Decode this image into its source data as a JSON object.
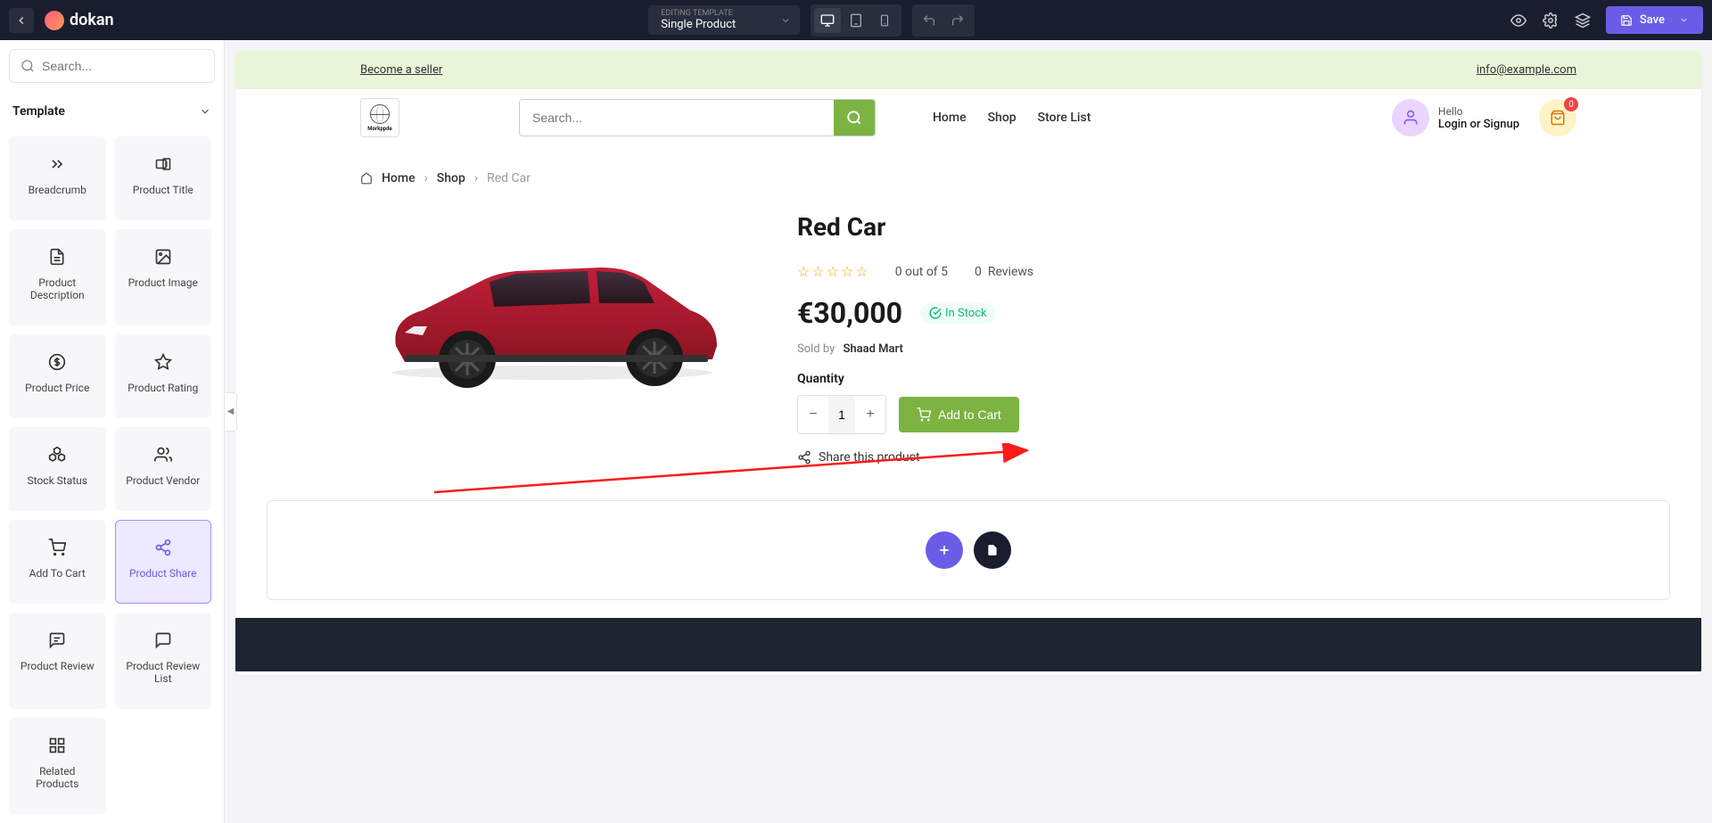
{
  "topbar": {
    "logo_text": "dokan",
    "template_label": "EDITING TEMPLATE",
    "template_name": "Single Product",
    "save_label": "Save"
  },
  "sidebar": {
    "search_placeholder": "Search...",
    "section_title": "Template",
    "widgets": [
      {
        "label": "Breadcrumb",
        "icon": "chevrons-right"
      },
      {
        "label": "Product Title",
        "icon": "text-cursor"
      },
      {
        "label": "Product Description",
        "icon": "file-text"
      },
      {
        "label": "Product Image",
        "icon": "image"
      },
      {
        "label": "Product Price",
        "icon": "dollar"
      },
      {
        "label": "Product Rating",
        "icon": "star"
      },
      {
        "label": "Stock Status",
        "icon": "boxes"
      },
      {
        "label": "Product Vendor",
        "icon": "users"
      },
      {
        "label": "Add To Cart",
        "icon": "cart"
      },
      {
        "label": "Product Share",
        "icon": "share",
        "selected": true
      },
      {
        "label": "Product Review",
        "icon": "chat"
      },
      {
        "label": "Product Review List",
        "icon": "chat-list"
      },
      {
        "label": "Related Products",
        "icon": "grid"
      }
    ]
  },
  "canvas": {
    "promo": {
      "seller_link": "Become a seller",
      "email": "info@example.com"
    },
    "header": {
      "search_placeholder": "Search...",
      "nav": [
        "Home",
        "Shop",
        "Store List"
      ],
      "greeting": "Hello",
      "login_text": "Login or Signup",
      "cart_count": "0"
    },
    "breadcrumb": {
      "home": "Home",
      "shop": "Shop",
      "current": "Red Car"
    },
    "product": {
      "title": "Red Car",
      "rating_text": "0 out of 5",
      "reviews_count": "0",
      "reviews_label": "Reviews",
      "price": "€30,000",
      "stock_label": "In Stock",
      "sold_by_label": "Sold by",
      "vendor": "Shaad Mart",
      "qty_label": "Quantity",
      "qty_value": "1",
      "add_to_cart": "Add to Cart",
      "share_label": "Share this product"
    }
  }
}
